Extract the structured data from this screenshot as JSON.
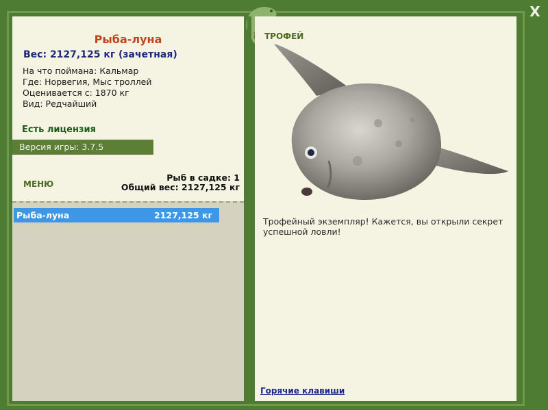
{
  "fish": {
    "name": "Рыба-луна",
    "weight_line": "Вес: 2127,125 кг (зачетная)",
    "bait": "На что поймана: Кальмар",
    "place": "Где: Норвегия, Мыс троллей",
    "rated_from": "Оценивается с: 1870 кг",
    "kind": "Вид: Редчайший"
  },
  "license": "Есть лицензия",
  "version": "Версия игры: 3.7.5",
  "menu_label": "МЕНЮ",
  "cage": {
    "count": "Рыб в садке: 1",
    "total": "Общий вес: 2127,125 кг"
  },
  "list": [
    {
      "name": "Рыба-луна",
      "weight": "2127,125 кг"
    }
  ],
  "trophy_label": "ТРОФЕЙ",
  "description": "Трофейный экземпляр! Кажется, вы открыли секрет успешной ловли!",
  "hotkeys": "Горячие клавиши",
  "close_label": "X",
  "icons": {
    "close": "close-icon",
    "logo": "lizard-logo-icon"
  }
}
